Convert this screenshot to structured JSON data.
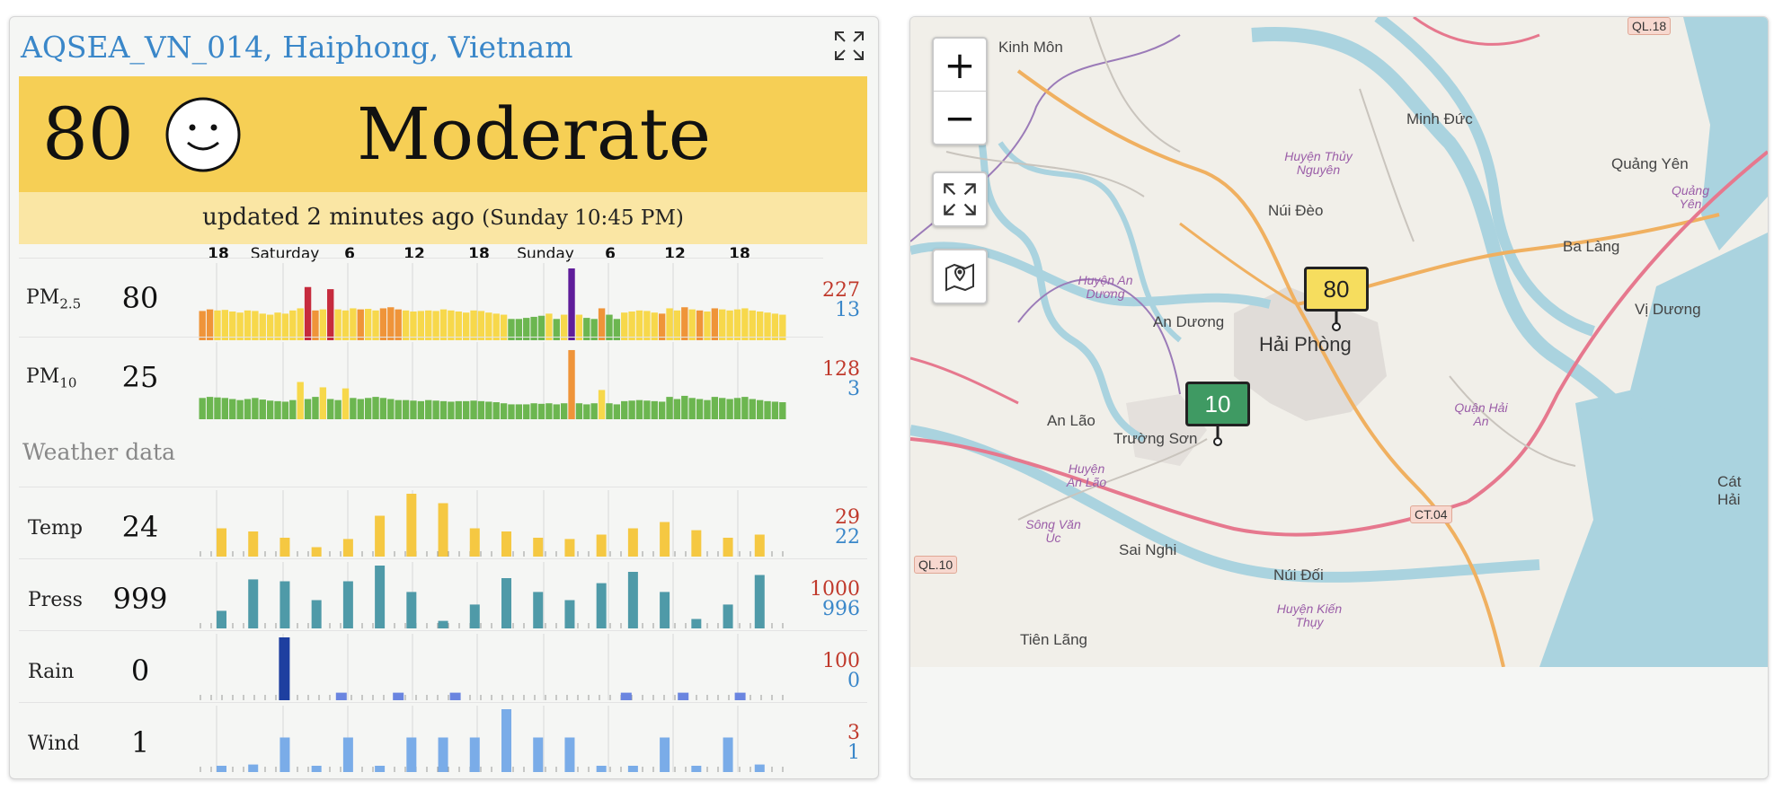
{
  "station": {
    "title": "AQSEA_VN_014, Haiphong, Vietnam"
  },
  "aqi": {
    "value": "80",
    "level": "Moderate",
    "face": "smiley-face",
    "color": "#f6cf55"
  },
  "updated": {
    "text": "updated 2 minutes ago",
    "time": "(Sunday 10:45 PM)"
  },
  "time_axis": [
    {
      "label": "18",
      "bold": true
    },
    {
      "label": "Saturday",
      "bold": false
    },
    {
      "label": "6",
      "bold": true
    },
    {
      "label": "12",
      "bold": true
    },
    {
      "label": "18",
      "bold": true
    },
    {
      "label": "Sunday",
      "bold": false
    },
    {
      "label": "6",
      "bold": true
    },
    {
      "label": "12",
      "bold": true
    },
    {
      "label": "18",
      "bold": true
    }
  ],
  "pollutants": [
    {
      "name": "PM",
      "sub": "2.5",
      "value": "80",
      "max": "227",
      "min": "13",
      "bars": [
        55,
        58,
        56,
        57,
        54,
        52,
        56,
        55,
        50,
        48,
        52,
        50,
        56,
        60,
        100,
        56,
        58,
        96,
        58,
        56,
        60,
        58,
        59,
        56,
        60,
        62,
        58,
        56,
        54,
        55,
        56,
        55,
        58,
        56,
        54,
        52,
        56,
        55,
        52,
        50,
        48,
        40,
        40,
        42,
        44,
        46,
        50,
        40,
        48,
        135,
        48,
        42,
        40,
        60,
        48,
        40,
        52,
        54,
        56,
        55,
        52,
        50,
        60,
        56,
        62,
        58,
        56,
        54,
        60,
        58,
        56,
        58,
        60,
        56,
        54,
        52,
        50,
        48
      ],
      "bar_colors": [
        "o",
        "o",
        "y",
        "y",
        "y",
        "y",
        "y",
        "y",
        "y",
        "y",
        "y",
        "y",
        "y",
        "y",
        "r",
        "o",
        "y",
        "r",
        "y",
        "y",
        "y",
        "o",
        "y",
        "y",
        "o",
        "o",
        "o",
        "y",
        "y",
        "y",
        "y",
        "y",
        "y",
        "y",
        "y",
        "y",
        "y",
        "y",
        "y",
        "y",
        "y",
        "g",
        "g",
        "g",
        "g",
        "g",
        "y",
        "g",
        "y",
        "p",
        "y",
        "g",
        "g",
        "o",
        "g",
        "g",
        "y",
        "y",
        "y",
        "y",
        "y",
        "o",
        "y",
        "y",
        "o",
        "y",
        "o",
        "y",
        "o",
        "y",
        "y",
        "y",
        "y",
        "y",
        "y",
        "y",
        "y",
        "y"
      ]
    },
    {
      "name": "PM",
      "sub": "10",
      "value": "25",
      "max": "128",
      "min": "3",
      "bars": [
        40,
        42,
        41,
        40,
        38,
        36,
        38,
        40,
        37,
        35,
        34,
        33,
        36,
        70,
        38,
        42,
        60,
        38,
        36,
        58,
        40,
        38,
        40,
        42,
        40,
        38,
        36,
        36,
        35,
        34,
        36,
        35,
        34,
        33,
        34,
        34,
        35,
        34,
        33,
        32,
        30,
        28,
        28,
        28,
        30,
        29,
        30,
        28,
        30,
        130,
        30,
        28,
        30,
        55,
        30,
        28,
        34,
        35,
        36,
        35,
        34,
        33,
        42,
        38,
        44,
        40,
        38,
        36,
        42,
        40,
        38,
        40,
        42,
        38,
        36,
        34,
        33,
        32
      ],
      "bar_colors": [
        "g",
        "g",
        "g",
        "g",
        "g",
        "g",
        "g",
        "g",
        "g",
        "g",
        "g",
        "g",
        "g",
        "y",
        "g",
        "g",
        "y",
        "g",
        "g",
        "y",
        "g",
        "g",
        "g",
        "g",
        "g",
        "g",
        "g",
        "g",
        "g",
        "g",
        "g",
        "g",
        "g",
        "g",
        "g",
        "g",
        "g",
        "g",
        "g",
        "g",
        "g",
        "g",
        "g",
        "g",
        "g",
        "g",
        "g",
        "g",
        "g",
        "o",
        "g",
        "g",
        "g",
        "y",
        "g",
        "g",
        "g",
        "g",
        "g",
        "g",
        "g",
        "g",
        "g",
        "g",
        "g",
        "g",
        "g",
        "g",
        "g",
        "g",
        "g",
        "g",
        "g",
        "g",
        "g",
        "g",
        "g",
        "g"
      ]
    }
  ],
  "weather": {
    "heading": "Weather data",
    "rows": [
      {
        "name": "Temp",
        "value": "24",
        "max": "29",
        "min": "22",
        "color": "#f5c842",
        "bars": [
          0.45,
          0.4,
          0.3,
          0.15,
          0.28,
          0.65,
          1.0,
          0.85,
          0.45,
          0.4,
          0.3,
          0.28,
          0.35,
          0.45,
          0.55,
          0.42,
          0.3,
          0.35
        ]
      },
      {
        "name": "Press",
        "value": "999",
        "max": "1000",
        "min": "996",
        "color": "#4f9aa8",
        "bars": [
          0.28,
          0.78,
          0.75,
          0.45,
          0.75,
          1.0,
          0.58,
          0.12,
          0.38,
          0.8,
          0.58,
          0.45,
          0.72,
          0.9,
          0.58,
          0.15,
          0.38,
          0.85
        ]
      },
      {
        "name": "Rain",
        "value": "0",
        "max": "100",
        "min": "0",
        "color": "#6a85e0",
        "bars": [
          0,
          1.0,
          0.12,
          0.12,
          0.12,
          0,
          0,
          0.12,
          0.12,
          0.12
        ],
        "bar_colors": [
          "#6a85e0",
          "#1e3fa0",
          "#6a85e0",
          "#6a85e0",
          "#6a85e0",
          "#6a85e0",
          "#6a85e0",
          "#6a85e0",
          "#6a85e0",
          "#6a85e0"
        ]
      },
      {
        "name": "Wind",
        "value": "1",
        "max": "3",
        "min": "1",
        "color": "#7aace8",
        "bars": [
          0.1,
          0.12,
          0.55,
          0.1,
          0.55,
          0.1,
          0.55,
          0.55,
          0.55,
          1.0,
          0.55,
          0.55,
          0.1,
          0.1,
          0.55,
          0.1,
          0.55,
          0.12
        ]
      }
    ]
  },
  "map": {
    "zoom_in": "+",
    "zoom_out": "−",
    "places": [
      "Kinh Môn",
      "Minh Đức",
      "Quảng Yên",
      "Núi Đèo",
      "Ba Làng",
      "Vị Dương",
      "An Dương",
      "Hải Phòng",
      "An Lão",
      "Trường Sơn",
      "Sai Nghi",
      "Núi Đối",
      "Tiên Lãng",
      "Cát Hải"
    ],
    "districts": [
      "Huyện Thủy Nguyên",
      "Huyện An Dương",
      "Huyện An Lão",
      "Sông Văn Úc",
      "Quận Hải An",
      "Huyện Kiến Thụy",
      "Quảng Yên"
    ],
    "roads": [
      "QL.18",
      "CT.04",
      "QL.10"
    ],
    "markers": [
      {
        "value": "80",
        "color": "#f6dd5e",
        "text_color": "#222"
      },
      {
        "value": "10",
        "color": "#3f9a63",
        "text_color": "#fff"
      }
    ]
  },
  "level_colors": {
    "g": "#6cb650",
    "y": "#f7d84b",
    "o": "#ef9439",
    "r": "#c62b3d",
    "p": "#5f1d9a"
  }
}
